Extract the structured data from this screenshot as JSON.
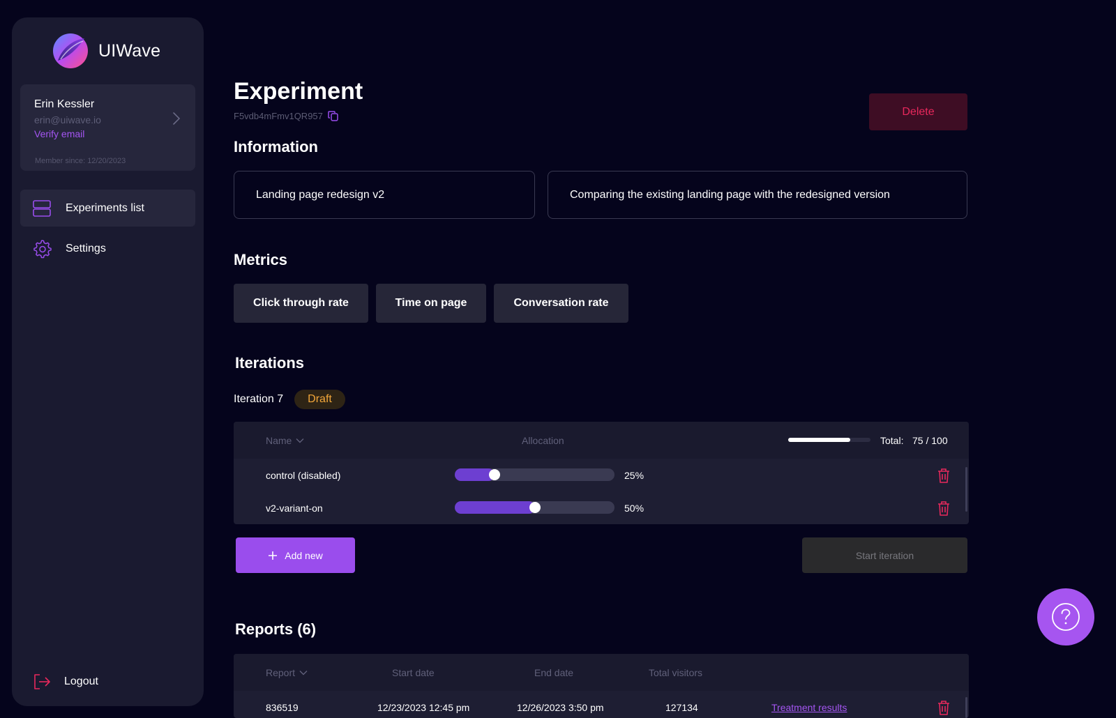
{
  "brand": {
    "name": "UIWave"
  },
  "user": {
    "name": "Erin Kessler",
    "email": "erin@uiwave.io",
    "verify_label": "Verify email",
    "member_since": "Member since: 12/20/2023"
  },
  "nav": {
    "items": [
      {
        "label": "Experiments list",
        "icon": "list-icon",
        "active": true
      },
      {
        "label": "Settings",
        "icon": "gear-icon",
        "active": false
      }
    ],
    "logout_label": "Logout"
  },
  "experiment": {
    "title": "Experiment",
    "id": "F5vdb4mFmv1QR957",
    "delete_label": "Delete"
  },
  "information": {
    "heading": "Information",
    "name": "Landing page redesign v2",
    "description": "Comparing the existing landing page with the redesigned version"
  },
  "metrics": {
    "heading": "Metrics",
    "items": [
      "Click through rate",
      "Time on page",
      "Conversation rate"
    ]
  },
  "iterations": {
    "heading": "Iterations",
    "current_label": "Iteration 7",
    "status": "Draft",
    "columns": {
      "name": "Name",
      "allocation": "Allocation"
    },
    "total_label": "Total:",
    "total_value": "75 / 100",
    "total_fraction": 0.75,
    "variants": [
      {
        "name": "control (disabled)",
        "allocation": 25,
        "allocation_label": "25%"
      },
      {
        "name": "v2-variant-on",
        "allocation": 50,
        "allocation_label": "50%"
      }
    ],
    "add_label": "Add new",
    "start_label": "Start iteration"
  },
  "reports": {
    "heading": "Reports (6)",
    "columns": [
      "Report",
      "Start date",
      "End date",
      "Total visitors"
    ],
    "rows": [
      {
        "report": "836519",
        "start_date": "12/23/2023 12:45 pm",
        "end_date": "12/26/2023 3:50 pm",
        "visitors": "127134",
        "link": "Treatment results"
      }
    ]
  },
  "colors": {
    "background": "#05041c",
    "sidebar": "#1a1a30",
    "accent": "#9a4ded",
    "danger": "#e8285c",
    "draft": "#f3a73a"
  }
}
